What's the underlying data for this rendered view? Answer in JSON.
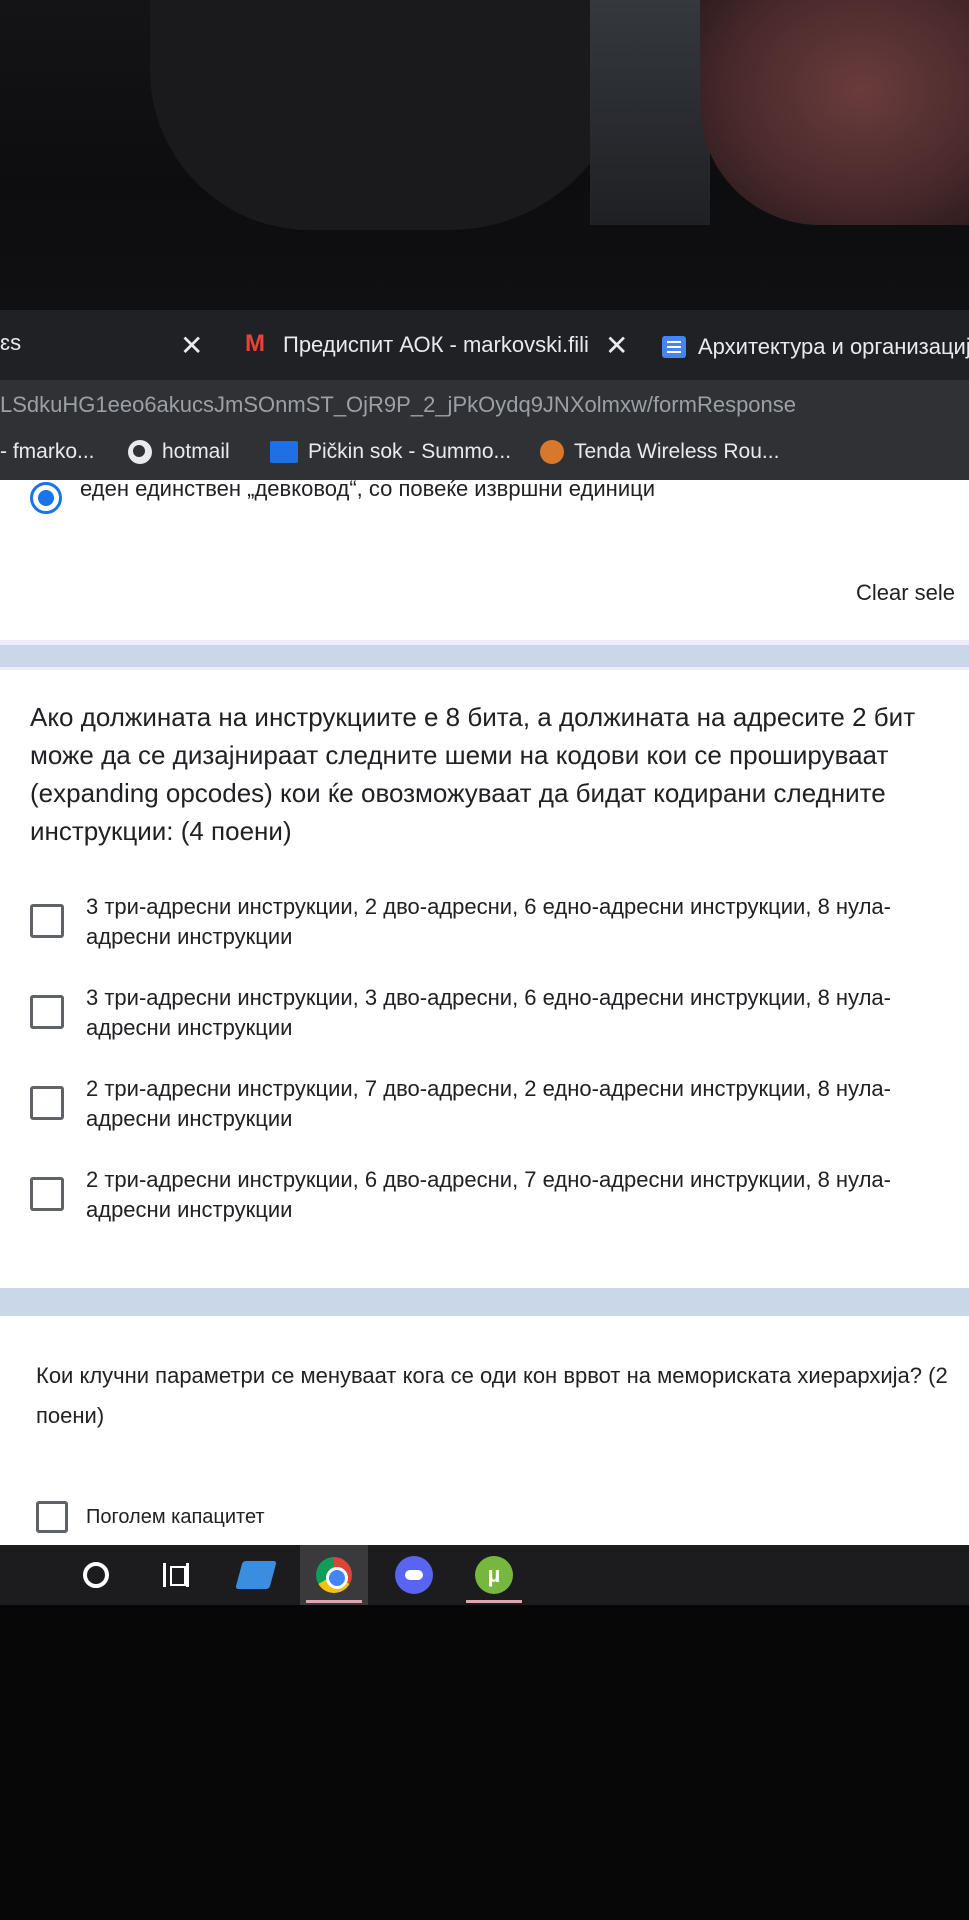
{
  "browser": {
    "tabs": [
      {
        "title": "",
        "close": "✕"
      },
      {
        "title": "Предиспит АОК - markovski.fili",
        "close": "✕",
        "icon": "gmail-icon"
      },
      {
        "title": "Архитектура и организација",
        "icon": "forms-icon"
      }
    ],
    "first_tab_partial": "ɛs",
    "url": "LSdkuHG1eeo6akucsJmSOnmST_OjR9P_2_jPkOydq9JNXolmxw/formResponse",
    "bookmarks": [
      {
        "label": "- fmarko..."
      },
      {
        "label": "hotmail",
        "icon": "globe-icon"
      },
      {
        "label": "Pičkin sok - Summo...",
        "icon": "blue-square-icon"
      },
      {
        "label": "Tenda Wireless Rou...",
        "icon": "tenda-icon"
      }
    ]
  },
  "form": {
    "previous_question": {
      "selected_option": "еден единствен „девковод“, со повеќе извршни единици",
      "clear_selection": "Clear sele"
    },
    "question_1": {
      "text": "Ако должината на инструкциите е 8 бита, а должината на адресите 2 бит може да се дизајнираат следните шеми на кодови кои се прошируваат (expanding opcodes) кои ќе овозможуваат да бидат кодирани следните инструкции: (4 поени)",
      "options": [
        "3 три-адресни инструкции, 2 дво-адресни, 6 едно-адресни инструкции, 8 нула-адресни инструкции",
        "3 три-адресни инструкции, 3 дво-адресни, 6 едно-адресни инструкции, 8 нула-адресни инструкции",
        "2 три-адресни инструкции, 7 дво-адресни, 2 едно-адресни инструкции, 8 нула-адресни инструкции",
        "2 три-адресни инструкции, 6 дво-адресни, 7 едно-адресни инструкции, 8 нула-адресни инструкции"
      ]
    },
    "question_2": {
      "text": "Кои клучни параметри се менуваат кога се оди кон врвот на мемориската хиерархија? (2 поени)",
      "options": [
        "Поголем капацитет"
      ]
    }
  },
  "taskbar": {
    "items": [
      "cortana-icon",
      "task-view-icon",
      "app-icon",
      "chrome-icon",
      "discord-icon",
      "utorrent-icon"
    ],
    "torrent_glyph": "µ"
  }
}
